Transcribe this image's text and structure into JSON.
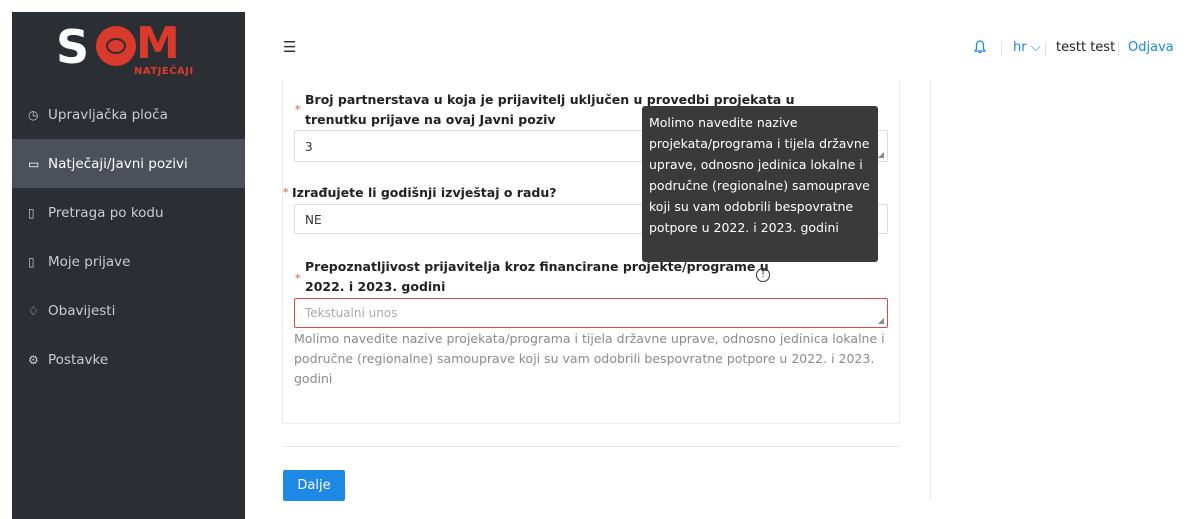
{
  "logo": {
    "brand": "S",
    "brand_end": "M",
    "sub": "NATJEČAJI"
  },
  "sidebar": {
    "items": [
      {
        "label": "Upravljačka ploča",
        "icon": "dashboard-icon",
        "glyph": "◷"
      },
      {
        "label": "Natječaji/Javni pozivi",
        "icon": "folder-icon",
        "glyph": "▭"
      },
      {
        "label": "Pretraga po kodu",
        "icon": "document-search-icon",
        "glyph": "▯"
      },
      {
        "label": "Moje prijave",
        "icon": "document-icon",
        "glyph": "▯"
      },
      {
        "label": "Obavijesti",
        "icon": "bell-icon",
        "glyph": "♢"
      },
      {
        "label": "Postavke",
        "icon": "gear-icon",
        "glyph": "⚙"
      }
    ]
  },
  "header": {
    "menu_glyph": "☰",
    "lang": "hr ⌵",
    "user": "testt test",
    "logout": "Odjava"
  },
  "form": {
    "q1_label_line1": "Broj partnerstava u koja je prijavitelj uključen u provedbi projekata u",
    "q1_label_line2": "trenutku prijave na ovaj Javni poziv",
    "q1_value": "3",
    "q2_label": "Izrađujete li godišnji izvještaj o radu?",
    "q2_value": "NE",
    "q3_label_line1": "Prepoznatljivost prijavitelja kroz financirane projekte/programe u",
    "q3_label_line2": "2022. i 2023. godini",
    "q3_placeholder": "Tekstualni unos",
    "q3_help": "Molimo navedite nazive projekata/programa i tijela državne uprave, odnosno jedinica lokalne i područne (regionalne) samouprave koji su vam odobrili bespovratne potpore u 2022. i 2023. godini",
    "required_mark": "*"
  },
  "tooltip": {
    "text": "Molimo navedite nazive projekata/programa i tijela državne uprave, odnosno jedinica lokalne i područne (regionalne) samouprave koji su vam odobrili bespovratne potpore u 2022. i 2023. godini"
  },
  "actions": {
    "next_label": "Dalje"
  },
  "colors": {
    "sidebar": "#2b2e32",
    "accent": "#1e88e5",
    "error": "#e04848",
    "brand_red": "#d93a2b"
  }
}
